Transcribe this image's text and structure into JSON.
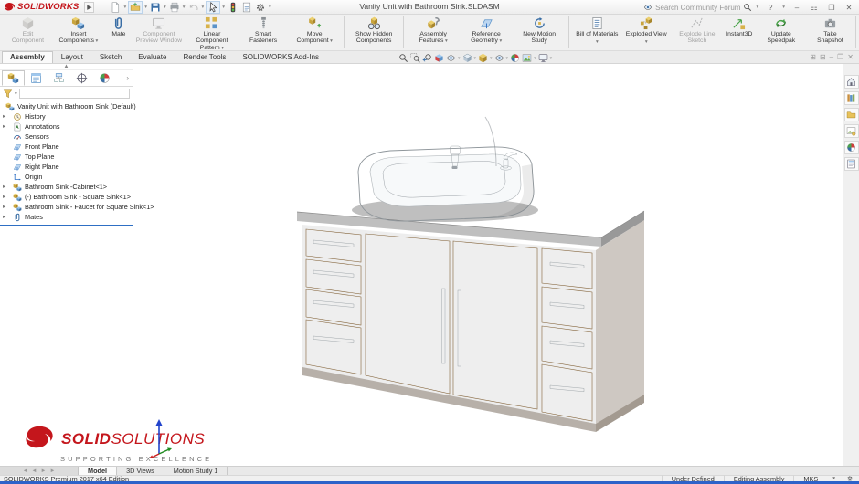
{
  "titlebar": {
    "brand": "SOLIDWORKS",
    "title": "Vanity Unit with Bathroom Sink.SLDASM",
    "search_label": "Search Community Forum",
    "help_label": "?"
  },
  "quick_access_icons": [
    "new-document",
    "open",
    "save",
    "print",
    "undo",
    "select",
    "rebuild-traffic-light",
    "file-properties",
    "options-gear"
  ],
  "ribbon": {
    "buttons": [
      {
        "label": "Edit Component",
        "disabled": true
      },
      {
        "label": "Insert Components",
        "caret": true
      },
      {
        "label": "Mate"
      },
      {
        "label": "Component Preview Window",
        "disabled": true
      },
      {
        "label": "Linear Component Pattern",
        "caret": true
      },
      {
        "label": "Smart Fasteners"
      },
      {
        "label": "Move Component",
        "caret": true
      },
      {
        "label": "Show Hidden Components"
      },
      {
        "label": "Assembly Features",
        "caret": true
      },
      {
        "label": "Reference Geometry",
        "caret": true
      },
      {
        "label": "New Motion Study"
      },
      {
        "label": "Bill of Materials",
        "caret": true
      },
      {
        "label": "Exploded View",
        "caret": true
      },
      {
        "label": "Explode Line Sketch",
        "disabled": true
      },
      {
        "label": "Instant3D"
      },
      {
        "label": "Update Speedpak"
      },
      {
        "label": "Take Snapshot"
      }
    ]
  },
  "command_tabs": [
    "Assembly",
    "Layout",
    "Sketch",
    "Evaluate",
    "Render Tools",
    "SOLIDWORKS Add-Ins"
  ],
  "headsup_icons": [
    "zoom-to-fit",
    "zoom-to-area",
    "previous-view",
    "section-view",
    "dynamic-annotation-views",
    "view-orientation",
    "display-style",
    "hide-show-items",
    "edit-appearance",
    "apply-scene",
    "view-settings"
  ],
  "feature_tree": {
    "root": "Vanity Unit with Bathroom Sink  (Default)",
    "items": [
      {
        "label": "History"
      },
      {
        "label": "Annotations"
      },
      {
        "label": "Sensors"
      },
      {
        "label": "Front Plane"
      },
      {
        "label": "Top Plane"
      },
      {
        "label": "Right Plane"
      },
      {
        "label": "Origin"
      },
      {
        "label": "Bathroom Sink -Cabinet<1>"
      },
      {
        "label": "(-) Bathroom Sink - Square Sink<1>"
      },
      {
        "label": "Bathroom Sink - Faucet for Square Sink<1>"
      },
      {
        "label": "Mates"
      }
    ]
  },
  "taskpane_icons": [
    "solidworks-resources",
    "design-library",
    "file-explorer",
    "view-palette",
    "appearances-scenes",
    "custom-properties"
  ],
  "viewport_logo": {
    "brand_bold": "SOLID",
    "brand_light": "SOLUTIONS",
    "tagline": "SUPPORTING EXCELLENCE"
  },
  "doc_tabs": [
    "Model",
    "3D Views",
    "Motion Study 1"
  ],
  "statusbar": {
    "edition": "SOLIDWORKS Premium 2017 x64 Edition",
    "state": "Under Defined",
    "mode": "Editing Assembly",
    "units": "MKS"
  },
  "colors": {
    "accent_blue": "#2e6fc4",
    "logo_red": "#c4161c",
    "wood": "#bb8f58",
    "wood_light": "#cba36b",
    "wood_side": "#9a7340",
    "wood_edge": "#7c5a2e",
    "granite": "#5c5c5c",
    "sink_white": "#ffffff",
    "chrome": "#c9cfd4",
    "ui_bg": "#f0f0f0"
  }
}
